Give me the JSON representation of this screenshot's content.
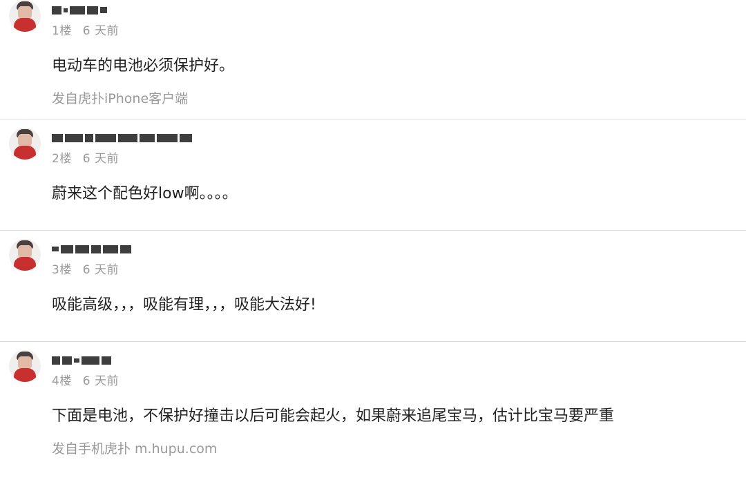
{
  "comments": [
    {
      "floor": "1楼",
      "time": "6 天前",
      "content": "电动车的电池必须保护好。",
      "source": "发自虎扑iPhone客户端"
    },
    {
      "floor": "2楼",
      "time": "6 天前",
      "content": "蔚来这个配色好low啊。。。。"
    },
    {
      "floor": "3楼",
      "time": "6 天前",
      "content": "吸能高级，，，吸能有理，，，吸能大法好!"
    },
    {
      "floor": "4楼",
      "time": "6 天前",
      "content": "下面是电池，不保护好撞击以后可能会起火，如果蔚来追尾宝马，估计比宝马要严重",
      "source": "发自手机虎扑 m.hupu.com"
    }
  ],
  "colors": {
    "meta_text": "#9a9a9a",
    "body_text": "#222222",
    "divider": "#dcdcdc",
    "avatar_shirt": "#c8302f"
  },
  "icons": {
    "avatar": "user-avatar-icon"
  }
}
